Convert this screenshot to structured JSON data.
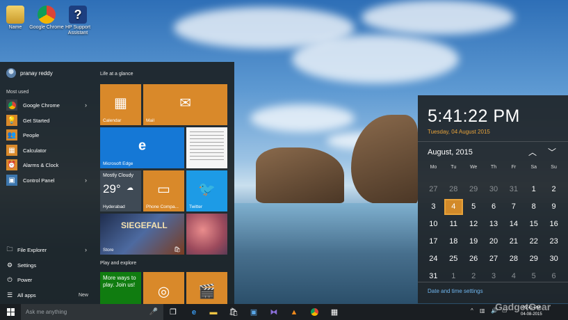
{
  "desktop": {
    "icons": [
      {
        "label": "Name"
      },
      {
        "label": "Google Chrome"
      },
      {
        "label": "HP Support Assistant"
      }
    ]
  },
  "start_menu": {
    "user_name": "pranay reddy",
    "most_used_label": "Most used",
    "most_used": [
      {
        "label": "Google Chrome",
        "icon": "chrome-icon",
        "has_submenu": true
      },
      {
        "label": "Get Started",
        "icon": "lightbulb-icon",
        "has_submenu": false
      },
      {
        "label": "People",
        "icon": "people-icon",
        "has_submenu": false
      },
      {
        "label": "Calculator",
        "icon": "calculator-icon",
        "has_submenu": false
      },
      {
        "label": "Alarms & Clock",
        "icon": "alarm-clock-icon",
        "has_submenu": false
      },
      {
        "label": "Control Panel",
        "icon": "control-panel-icon",
        "has_submenu": true
      }
    ],
    "bottom": {
      "file_explorer": "File Explorer",
      "settings": "Settings",
      "power": "Power",
      "all_apps": "All apps",
      "new_badge": "New"
    },
    "groups": {
      "life": "Life at a glance",
      "play": "Play and explore"
    },
    "tiles": {
      "calendar": "Calendar",
      "mail": "Mail",
      "edge": "Microsoft Edge",
      "weather_condition": "Mostly Cloudy",
      "weather_temp": "29°",
      "weather_city": "Hyderabad",
      "phone": "Phone Compa...",
      "twitter": "Twitter",
      "store": "Store",
      "store_game": "SIEGEFALL",
      "xbox_text": "More ways to play. Join us!"
    }
  },
  "clock": {
    "time": "5:41:22 PM",
    "date": "Tuesday, 04 August 2015",
    "month": "August, 2015",
    "days_of_week": [
      "Mo",
      "Tu",
      "We",
      "Th",
      "Fr",
      "Sa",
      "Su"
    ],
    "days": [
      {
        "d": "27",
        "dim": true
      },
      {
        "d": "28",
        "dim": true
      },
      {
        "d": "29",
        "dim": true
      },
      {
        "d": "30",
        "dim": true
      },
      {
        "d": "31",
        "dim": true
      },
      {
        "d": "1"
      },
      {
        "d": "2"
      },
      {
        "d": "3"
      },
      {
        "d": "4",
        "today": true
      },
      {
        "d": "5"
      },
      {
        "d": "6"
      },
      {
        "d": "7"
      },
      {
        "d": "8"
      },
      {
        "d": "9"
      },
      {
        "d": "10"
      },
      {
        "d": "11"
      },
      {
        "d": "12"
      },
      {
        "d": "13"
      },
      {
        "d": "14"
      },
      {
        "d": "15"
      },
      {
        "d": "16"
      },
      {
        "d": "17"
      },
      {
        "d": "18"
      },
      {
        "d": "19"
      },
      {
        "d": "20"
      },
      {
        "d": "21"
      },
      {
        "d": "22"
      },
      {
        "d": "23"
      },
      {
        "d": "24"
      },
      {
        "d": "25"
      },
      {
        "d": "26"
      },
      {
        "d": "27"
      },
      {
        "d": "28"
      },
      {
        "d": "29"
      },
      {
        "d": "30"
      },
      {
        "d": "31"
      },
      {
        "d": "1",
        "dim": true
      },
      {
        "d": "2",
        "dim": true
      },
      {
        "d": "3",
        "dim": true
      },
      {
        "d": "4",
        "dim": true
      },
      {
        "d": "5",
        "dim": true
      },
      {
        "d": "6",
        "dim": true
      }
    ],
    "settings_link": "Date and time settings"
  },
  "taskbar": {
    "search_placeholder": "Ask me anything",
    "tray_time": "05:41 PM",
    "tray_date": "04-08-2015"
  },
  "watermark": "GadgetGear",
  "colors": {
    "accent": "#d9892a",
    "link": "#6fb5ef",
    "taskbar": "#1a1e22"
  }
}
